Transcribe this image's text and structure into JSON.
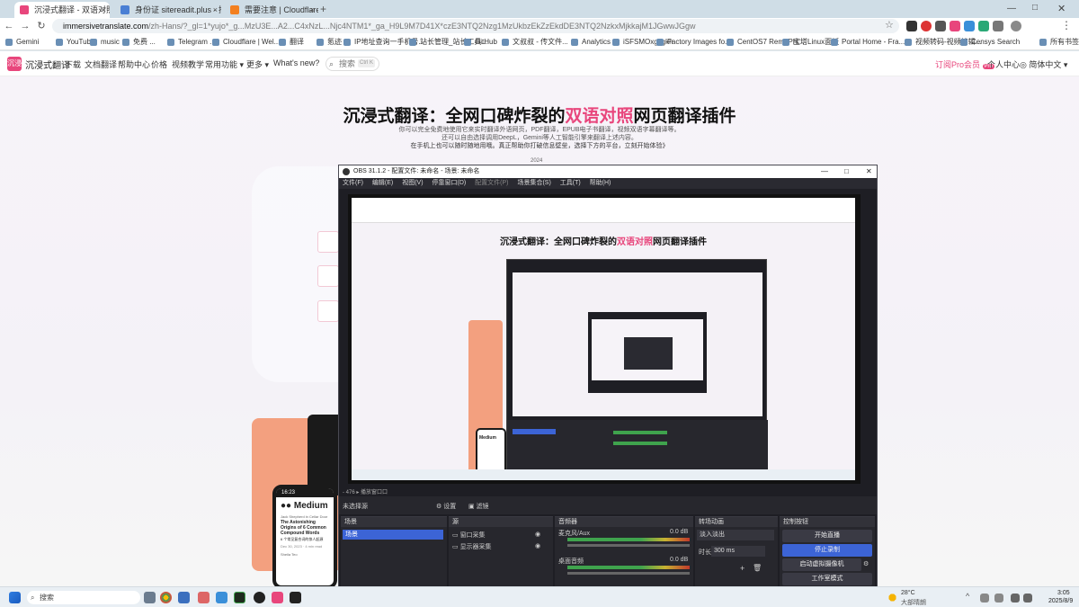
{
  "browser": {
    "tabs": [
      {
        "label": "沉浸式翻译 - 双语对照网页翻...",
        "active": true
      },
      {
        "label": "身份证 sitereadit.plus - 搜索",
        "active": false
      },
      {
        "label": "需要注意 | Cloudflare",
        "active": false
      }
    ],
    "new_tab": "+",
    "url_main": "immersivetranslate.com",
    "url_rest": "/zh-Hans/?_gl=1*yujo*_g...MzU3E...A2...C4xNzL...Njc4NTM1*_ga_H9L9M7D41X*czE3NTQ2Nzg1MzUkbzEkZzEkdDE3NTQ2NzkxMjkkajM1JGwwJGgw",
    "bookmarks": [
      "Gemini",
      "YouTube",
      "music",
      "免费 ...",
      "Telegram ...",
      "Cloudflare | Wel...",
      "翻译",
      "氪迹",
      "IP地址查询一手机号...",
      "站长管理_站长工具...",
      "GitHub",
      "文叔叔 - 传文件...",
      "Analytics",
      "iSFSMOxgvgkh",
      "Factory Images fo...",
      "CentOS7 Remi-PH...",
      "宝塔Linux面板",
      "Portal Home - Fra...",
      "视频转码-视频编辑...",
      "Censys Search",
      "所有书签"
    ]
  },
  "site": {
    "logo": "沉浸",
    "brand": "沉浸式翻译",
    "nav": [
      "下载",
      "文档翻译",
      "帮助中心",
      "价格",
      "视频教学",
      "常用功能 ▾",
      "更多 ▾",
      "What's new?"
    ],
    "search_placeholder": "搜索",
    "search_kbd": "Ctrl K",
    "pro_link": "订阅Pro会员",
    "pro_badge": "Pro",
    "account": "个人中心",
    "language": "简体中文 ▾"
  },
  "hero": {
    "title_a": "沉浸式翻译：全网口碑炸裂的",
    "title_hl": "双语对照",
    "title_b": "网页翻译插件",
    "line1": "你可以完全免费地使用它来实时翻译外语网页，PDF翻译，EPUB电子书翻译，视频双语字幕翻译等。",
    "line2": "还可以自由选择调用DeepL，Gemini等人工智能引擎来翻译上述内容。",
    "line3": "在手机上也可以随时随地用哦。真正帮助你打破信息壁垒，选择下方的平台，立刻开始体验》",
    "year": "2024"
  },
  "obs": {
    "title": "OBS 31.1.2 - 配置文件: 未命名 - 场景: 未命名",
    "menu": [
      "文件(F)",
      "编辑(E)",
      "视图(V)",
      "停靠窗口(D)",
      "配置文件(P)",
      "场景集合(S)",
      "工具(T)",
      "帮助(H)"
    ],
    "status_line": "- 476  ▸  播放窗口口",
    "no_source": "未选择源",
    "props_btn": "设置",
    "filters_btn": "滤镜",
    "scenes": {
      "title": "场景",
      "items": [
        "场景"
      ]
    },
    "sources": {
      "title": "源",
      "items": [
        "窗口采集",
        "显示器采集"
      ]
    },
    "mixer": {
      "title": "音频器",
      "channels": [
        {
          "name": "麦克风/Aux",
          "db": "0.0 dB"
        },
        {
          "name": "桌面音频",
          "db": "0.0 dB"
        }
      ]
    },
    "transitions": {
      "title": "转场动画",
      "value": "淡入淡出",
      "duration_label": "时长",
      "duration": "300 ms"
    },
    "controls": {
      "title": "控制按钮",
      "buttons": [
        "开始直播",
        "停止录制",
        "启动虚拟摄像机",
        "工作室模式"
      ]
    }
  },
  "phone": {
    "time": "16:23",
    "app": "Medium",
    "author": "Jack Shepherd in Cellar Door",
    "headline": "The Astonishing Origins of 6 Common Compound Words",
    "headline_zh": "6 个常见复合词的惊人起源",
    "meta": "Dec 30, 2023 · 4 min read",
    "author2": "Sheila Teo"
  },
  "taskbar": {
    "search": "搜索",
    "weather_temp": "28°C",
    "weather_desc": "大部晴朗",
    "time": "3:05",
    "date": "2025/8/9"
  }
}
